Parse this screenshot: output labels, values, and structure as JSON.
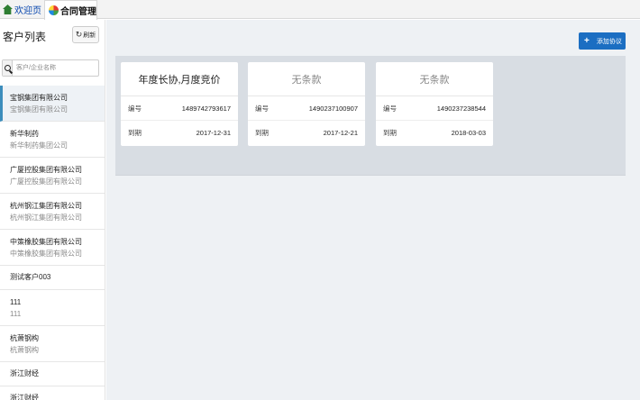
{
  "tabs": [
    {
      "label": "欢迎页"
    },
    {
      "label": "合同管理"
    }
  ],
  "sidebar": {
    "title": "客户列表",
    "refresh_label": "刷新",
    "search_placeholder": "客户/企业名称",
    "customers": [
      {
        "name": "宝钢集团有限公司",
        "sub": "宝钢集团有限公司"
      },
      {
        "name": "新华制药",
        "sub": "新华制药集团公司"
      },
      {
        "name": "广厦控股集团有限公司",
        "sub": "广厦控股集团有限公司"
      },
      {
        "name": "杭州钢江集团有限公司",
        "sub": "杭州钢江集团有限公司"
      },
      {
        "name": "中策橡胶集团有限公司",
        "sub": "中策橡胶集团有限公司"
      },
      {
        "name": "测试客户003",
        "sub": ""
      },
      {
        "name": "111",
        "sub": "111"
      },
      {
        "name": "杭萧钢构",
        "sub": "杭萧钢构"
      },
      {
        "name": "浙江财经",
        "sub": ""
      },
      {
        "name": "浙江财经",
        "sub": ""
      }
    ]
  },
  "main": {
    "add_label": "添加协议",
    "cards": [
      {
        "title": "年度长协,月度竞价",
        "no_label": "编号",
        "no": "1489742793617",
        "date_label": "到期",
        "date": "2017-12-31"
      },
      {
        "title": "无条款",
        "no_label": "编号",
        "no": "1490237100907",
        "date_label": "到期",
        "date": "2017-12-21"
      },
      {
        "title": "无条款",
        "no_label": "编号",
        "no": "1490237238544",
        "date_label": "到期",
        "date": "2018-03-03"
      }
    ]
  }
}
